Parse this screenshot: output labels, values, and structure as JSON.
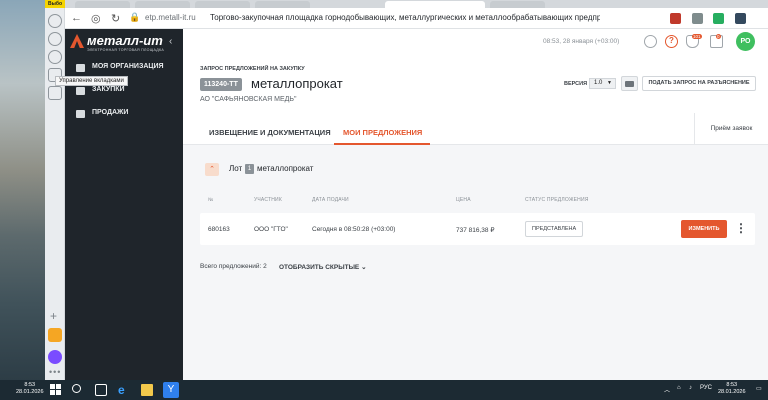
{
  "browser": {
    "badge": "Выбо",
    "url": "etp.metall-it.ru",
    "page_title": "Торгово-закупочная площадка горнодобывающих, металлургических и металлообрабатывающих предприятий || метал..."
  },
  "sidebar": {
    "logo_text": "металл-ит",
    "logo_sub": "ЭЛЕКТРОННАЯ ТОРГОВАЯ ПЛОЩАДКА",
    "tooltip": "Управление вкладками",
    "items": [
      {
        "label": "МОЯ ОРГАНИЗАЦИЯ",
        "icon": "id-card-icon"
      },
      {
        "label": "ЗАКУПКИ",
        "icon": "box-icon"
      },
      {
        "label": "ПРОДАЖИ",
        "icon": "cart-icon"
      }
    ]
  },
  "header": {
    "datetime": "08:53, 28 января (+03:00)",
    "notif_badge": "101",
    "mail_badge": "0",
    "avatar": "РО"
  },
  "request": {
    "crumb": "ЗАПРОС ПРЕДЛОЖЕНИЙ НА ЗАКУПКУ",
    "number": "113240-ТТ",
    "title": "металлопрокат",
    "company": "АО \"САФЬЯНОВСКАЯ МЕДЬ\"",
    "version_label": "ВЕРСИЯ",
    "version_value": "1.0",
    "clarify_button": "ПОДАТЬ ЗАПРОС НА РАЗЪЯСНЕНИЕ"
  },
  "tabs": {
    "notice": "ИЗВЕЩЕНИЕ И ДОКУМЕНТАЦИЯ",
    "offers": "МОИ ПРЕДЛОЖЕНИЯ",
    "receiving": "Приём заявок"
  },
  "lot": {
    "word": "Лот",
    "number": "1",
    "name": "металлопрокат"
  },
  "table": {
    "headers": [
      "№",
      "УЧАСТНИК",
      "ДАТА ПОДАЧИ",
      "ЦЕНА",
      "СТАТУС ПРЕДЛОЖЕНИЯ"
    ],
    "row": {
      "num": "680163",
      "participant": "ООО \"ГТО\"",
      "date": "Сегодня в 08:50:28 (+03:00)",
      "price": "737 816,38 ₽",
      "status": "ПРЕДСТАВЛЕНА",
      "edit": "ИЗМЕНИТЬ"
    }
  },
  "footer": {
    "total": "Всего предложений: 2",
    "show_hidden": "ОТОБРАЗИТЬ СКРЫТЫЕ"
  },
  "taskbar": {
    "left_time": "8:53",
    "left_date": "28.01.2026",
    "lang": "РУС",
    "time": "8:53",
    "date": "28.01.2026"
  },
  "colors": {
    "accent": "#e4572e",
    "sidebar": "#1f252b",
    "avatar": "#3fbf5f"
  }
}
